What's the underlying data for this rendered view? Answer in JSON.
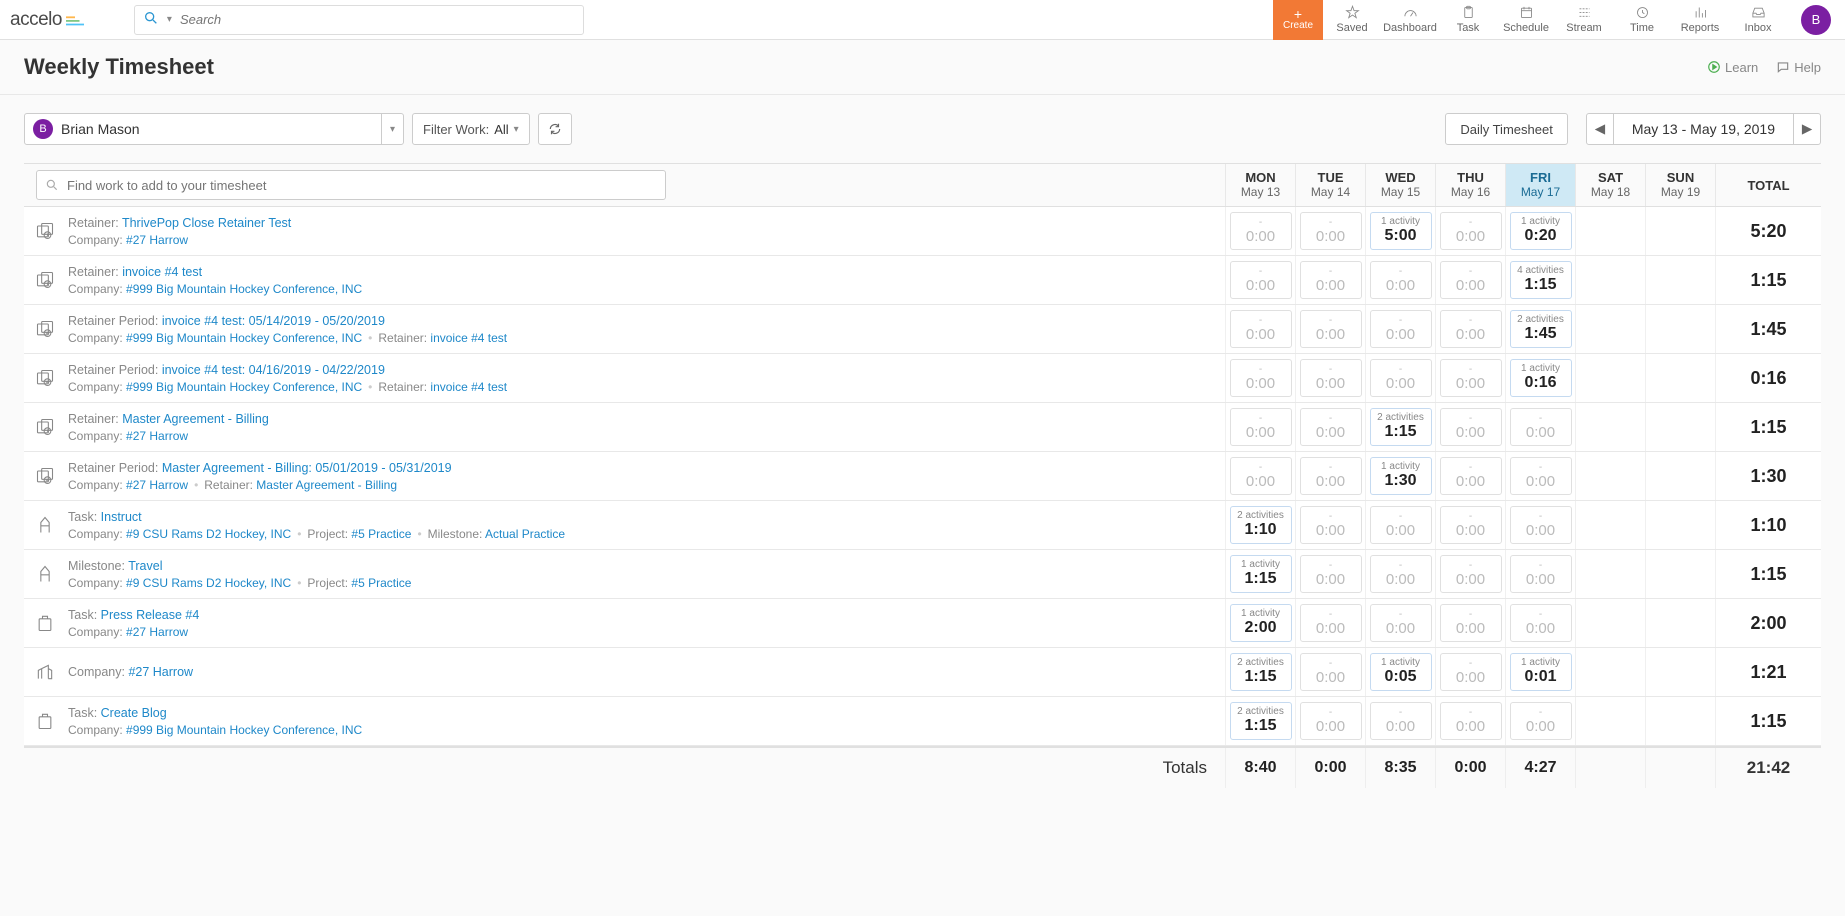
{
  "brand": "accelo",
  "search": {
    "placeholder": "Search"
  },
  "top_actions": {
    "create": "Create",
    "saved": "Saved",
    "dashboard": "Dashboard",
    "task": "Task",
    "schedule": "Schedule",
    "stream": "Stream",
    "time": "Time",
    "reports": "Reports",
    "inbox": "Inbox"
  },
  "avatar_initial": "B",
  "page_title": "Weekly Timesheet",
  "learn": "Learn",
  "help": "Help",
  "user": {
    "initial": "B",
    "name": "Brian Mason"
  },
  "filter": {
    "label": "Filter Work:",
    "value": "All"
  },
  "daily_btn": "Daily Timesheet",
  "date_range": "May 13 - May 19, 2019",
  "find_placeholder": "Find work to add to your timesheet",
  "days": [
    {
      "name": "MON",
      "date": "May 13"
    },
    {
      "name": "TUE",
      "date": "May 14"
    },
    {
      "name": "WED",
      "date": "May 15"
    },
    {
      "name": "THU",
      "date": "May 16"
    },
    {
      "name": "FRI",
      "date": "May 17",
      "active": true
    },
    {
      "name": "SAT",
      "date": "May 18"
    },
    {
      "name": "SUN",
      "date": "May 19"
    }
  ],
  "total_label": "TOTAL",
  "rows": [
    {
      "icon": "retainer",
      "title_label": "Retainer:",
      "title_link": "ThrivePop Close Retainer Test",
      "meta": [
        [
          "Company:",
          "#27 Harrow"
        ]
      ],
      "cells": [
        null,
        null,
        {
          "label": "1 activity",
          "val": "5:00"
        },
        null,
        {
          "label": "1 activity",
          "val": "0:20"
        },
        "",
        ""
      ],
      "total": "5:20"
    },
    {
      "icon": "retainer",
      "title_label": "Retainer:",
      "title_link": "invoice #4 test",
      "meta": [
        [
          "Company:",
          "#999 Big Mountain Hockey Conference, INC"
        ]
      ],
      "cells": [
        null,
        null,
        null,
        null,
        {
          "label": "4 activities",
          "val": "1:15"
        },
        "",
        ""
      ],
      "total": "1:15"
    },
    {
      "icon": "retainer-period",
      "title_label": "Retainer Period:",
      "title_link": "invoice #4 test: 05/14/2019 - 05/20/2019",
      "meta": [
        [
          "Company:",
          "#999 Big Mountain Hockey Conference, INC"
        ],
        [
          "Retainer:",
          "invoice #4 test"
        ]
      ],
      "cells": [
        null,
        null,
        null,
        null,
        {
          "label": "2 activities",
          "val": "1:45"
        },
        "",
        ""
      ],
      "total": "1:45"
    },
    {
      "icon": "retainer-period",
      "title_label": "Retainer Period:",
      "title_link": "invoice #4 test: 04/16/2019 - 04/22/2019",
      "meta": [
        [
          "Company:",
          "#999 Big Mountain Hockey Conference, INC"
        ],
        [
          "Retainer:",
          "invoice #4 test"
        ]
      ],
      "cells": [
        null,
        null,
        null,
        null,
        {
          "label": "1 activity",
          "val": "0:16"
        },
        "",
        ""
      ],
      "total": "0:16"
    },
    {
      "icon": "retainer",
      "title_label": "Retainer:",
      "title_link": "Master Agreement - Billing",
      "meta": [
        [
          "Company:",
          "#27 Harrow"
        ]
      ],
      "cells": [
        null,
        null,
        {
          "label": "2 activities",
          "val": "1:15"
        },
        null,
        null,
        "",
        ""
      ],
      "total": "1:15"
    },
    {
      "icon": "retainer-period",
      "title_label": "Retainer Period:",
      "title_link": "Master Agreement - Billing: 05/01/2019 - 05/31/2019",
      "meta": [
        [
          "Company:",
          "#27 Harrow"
        ],
        [
          "Retainer:",
          "Master Agreement - Billing"
        ]
      ],
      "cells": [
        null,
        null,
        {
          "label": "1 activity",
          "val": "1:30"
        },
        null,
        null,
        "",
        ""
      ],
      "total": "1:30"
    },
    {
      "icon": "task",
      "title_label": "Task:",
      "title_link": "Instruct",
      "meta": [
        [
          "Company:",
          "#9 CSU Rams D2 Hockey, INC"
        ],
        [
          "Project:",
          "#5 Practice"
        ],
        [
          "Milestone:",
          "Actual Practice"
        ]
      ],
      "cells": [
        {
          "label": "2 activities",
          "val": "1:10"
        },
        null,
        null,
        null,
        null,
        "",
        ""
      ],
      "total": "1:10"
    },
    {
      "icon": "task",
      "title_label": "Milestone:",
      "title_link": "Travel",
      "meta": [
        [
          "Company:",
          "#9 CSU Rams D2 Hockey, INC"
        ],
        [
          "Project:",
          "#5 Practice"
        ]
      ],
      "cells": [
        {
          "label": "1 activity",
          "val": "1:15"
        },
        null,
        null,
        null,
        null,
        "",
        ""
      ],
      "total": "1:15"
    },
    {
      "icon": "project",
      "title_label": "Task:",
      "title_link": "Press Release #4",
      "meta": [
        [
          "Company:",
          "#27 Harrow"
        ]
      ],
      "cells": [
        {
          "label": "1 activity",
          "val": "2:00"
        },
        null,
        null,
        null,
        null,
        "",
        ""
      ],
      "total": "2:00"
    },
    {
      "icon": "company",
      "title_label": "Company:",
      "title_link": "#27 Harrow",
      "meta": [],
      "cells": [
        {
          "label": "2 activities",
          "val": "1:15"
        },
        null,
        {
          "label": "1 activity",
          "val": "0:05"
        },
        null,
        {
          "label": "1 activity",
          "val": "0:01"
        },
        "",
        ""
      ],
      "total": "1:21"
    },
    {
      "icon": "project",
      "title_label": "Task:",
      "title_link": "Create Blog",
      "meta": [
        [
          "Company:",
          "#999 Big Mountain Hockey Conference, INC"
        ]
      ],
      "cells": [
        {
          "label": "2 activities",
          "val": "1:15"
        },
        null,
        null,
        null,
        null,
        "",
        ""
      ],
      "total": "1:15"
    }
  ],
  "totals": {
    "label": "Totals",
    "days": [
      "8:40",
      "0:00",
      "8:35",
      "0:00",
      "4:27",
      "",
      ""
    ],
    "grand": "21:42"
  }
}
